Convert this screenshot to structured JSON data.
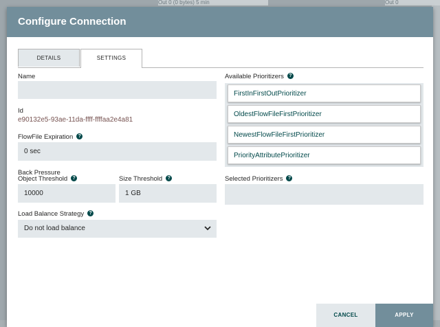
{
  "background": {
    "bar_left_text": "Out     0 (0 bytes)           5 min",
    "bar_right_text": "Out    0"
  },
  "dialog": {
    "title": "Configure Connection"
  },
  "tabs": [
    {
      "label": "DETAILS",
      "active": false
    },
    {
      "label": "SETTINGS",
      "active": true
    }
  ],
  "form": {
    "name_label": "Name",
    "name_value": "",
    "id_label": "Id",
    "id_value": "e90132e5-93ae-11da-ffff-ffffaa2e4a81",
    "expiration_label": "FlowFile Expiration",
    "expiration_value": "0 sec",
    "back_pressure_label": "Back Pressure",
    "object_threshold_label": "Object Threshold",
    "object_threshold_value": "10000",
    "size_threshold_label": "Size Threshold",
    "size_threshold_value": "1 GB",
    "load_balance_label": "Load Balance Strategy",
    "load_balance_value": "Do not load balance"
  },
  "prioritizers": {
    "available_label": "Available Prioritizers",
    "available": [
      "FirstInFirstOutPrioritizer",
      "OldestFlowFileFirstPrioritizer",
      "NewestFlowFileFirstPrioritizer",
      "PriorityAttributePrioritizer"
    ],
    "selected_label": "Selected Prioritizers"
  },
  "footer": {
    "cancel_label": "CANCEL",
    "apply_label": "APPLY"
  },
  "colors": {
    "header": "#728e9b",
    "field_bg": "#e3e8eb",
    "accent": "#004849",
    "id_text": "#775351"
  },
  "icons": {
    "help": "question-circle-icon",
    "dropdown": "chevron-down-icon"
  }
}
